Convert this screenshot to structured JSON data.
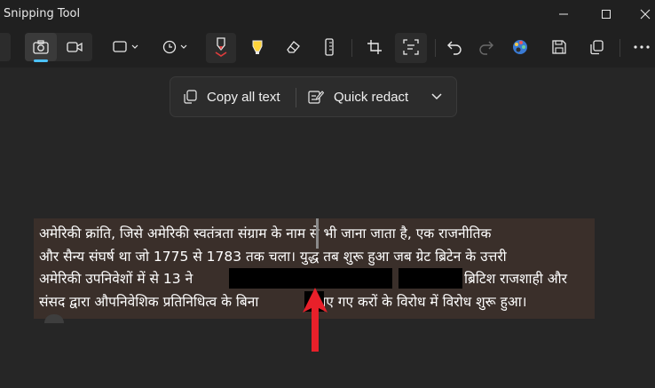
{
  "window": {
    "title": "Snipping Tool",
    "controls": {
      "minimize": "minimize",
      "maximize": "maximize",
      "close": "close"
    }
  },
  "toolbar": {
    "icons": [
      "camera-icon",
      "video-icon",
      "snip-shape-icon",
      "timer-icon",
      "ballpoint-pen-icon",
      "highlighter-icon",
      "eraser-icon",
      "ruler-icon",
      "crop-icon",
      "text-actions-icon",
      "undo-icon",
      "redo-icon",
      "paint-icon",
      "save-icon",
      "copy-icon",
      "more-icon"
    ],
    "accent_color": "#4cc2ff",
    "pen_color": "#e03c3c",
    "highlighter_color": "#ffd43b"
  },
  "text_actions": {
    "copy_all_text": "Copy all text",
    "quick_redact": "Quick redact"
  },
  "snip": {
    "lines": [
      "अमेरिकी क्रांति, जिसे अमेरिकी स्वतंत्रता संग्राम के नाम से भी जाना जाता है, एक राजनीतिक",
      "और सैन्य संघर्ष था जो 1775 से 1783 तक चला। युद्ध तब शुरू हुआ जब ग्रेट ब्रिटेन के उत्तरी",
      "अमेरिकी उपनिवेशों में से 13 ने",
      "ब्रिटिश राजशाही और",
      "संसद द्वारा औपनिवेशिक प्रतिनिधित्व के बिना",
      "लगाए गए करों के विरोध में विरोध शुरू हुआ।"
    ],
    "background_color": "#3a2f2a",
    "arrow_color": "#e8202a"
  }
}
